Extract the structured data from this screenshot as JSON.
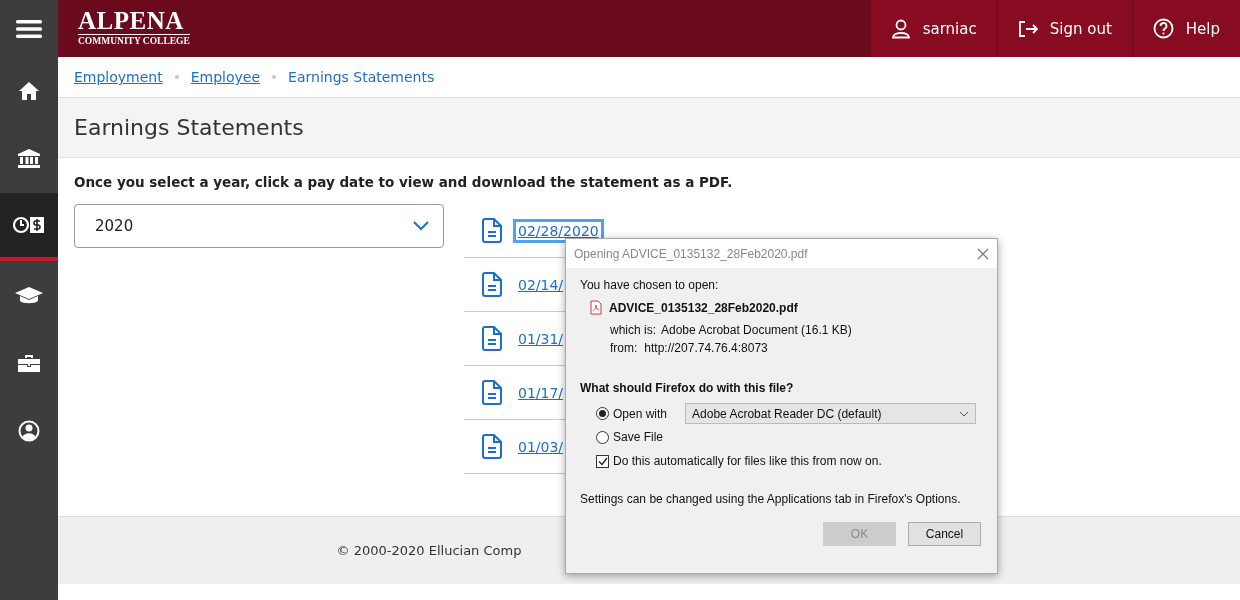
{
  "sidebar": {
    "items": [
      {
        "kind": "menu",
        "selected": false
      },
      {
        "kind": "home",
        "selected": false
      },
      {
        "kind": "bank",
        "selected": false
      },
      {
        "kind": "earnings",
        "selected": true
      },
      {
        "kind": "education",
        "selected": false
      },
      {
        "kind": "briefcase",
        "selected": false
      },
      {
        "kind": "profile",
        "selected": false
      }
    ]
  },
  "header": {
    "logo_title": "ALPENA",
    "logo_subtitle": "COMMUNITY COLLEGE",
    "actions": [
      {
        "kind": "user",
        "label": "sarniac"
      },
      {
        "kind": "signout",
        "label": "Sign out"
      },
      {
        "kind": "help",
        "label": "Help"
      }
    ]
  },
  "breadcrumbs": [
    {
      "label": "Employment",
      "link": true
    },
    {
      "label": "Employee",
      "link": true
    },
    {
      "label": "Earnings Statements",
      "link": false
    }
  ],
  "page_title": "Earnings Statements",
  "instructions": "Once you select a year, click a pay date to view and download the statement as a PDF.",
  "year_select": {
    "value": "2020"
  },
  "statements": [
    {
      "date": "02/28/2020",
      "focused": true
    },
    {
      "date": "02/14/",
      "focused": false
    },
    {
      "date": "01/31/",
      "focused": false
    },
    {
      "date": "01/17/",
      "focused": false
    },
    {
      "date": "01/03/",
      "focused": false
    }
  ],
  "footer": "© 2000-2020 Ellucian Comp",
  "dialog": {
    "title": "Opening ADVICE_0135132_28Feb2020.pdf",
    "intro": "You have chosen to open:",
    "file_name": "ADVICE_0135132_28Feb2020.pdf",
    "type_label": "which is:",
    "type_value": "Adobe Acrobat Document (16.1 KB)",
    "from_label": "from:",
    "from_value": "http://207.74.76.4:8073",
    "question": "What should Firefox do with this file?",
    "options": [
      {
        "label": "Open with",
        "selected": true
      },
      {
        "label": "Save File",
        "selected": false
      }
    ],
    "app_select": "Adobe Acrobat Reader DC (default)",
    "auto_checkbox": {
      "label": "Do this automatically for files like this from now on.",
      "checked": true
    },
    "note": "Settings can be changed using the Applications tab in Firefox's Options.",
    "buttons": [
      {
        "label": "OK",
        "disabled": true
      },
      {
        "label": "Cancel",
        "disabled": false
      }
    ]
  }
}
